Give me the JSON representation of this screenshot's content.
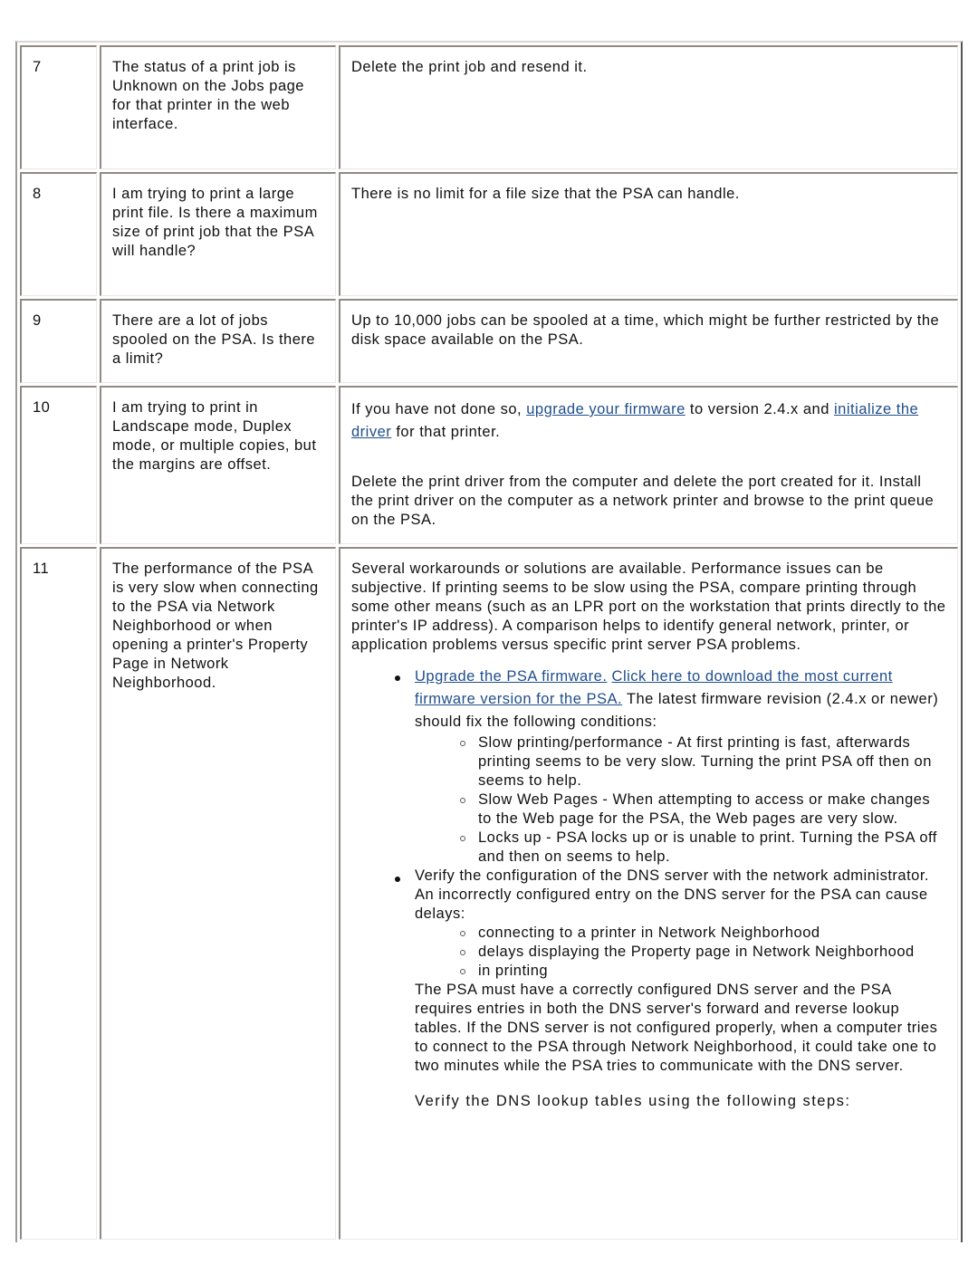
{
  "rows": [
    {
      "number": "7",
      "question": "The status of a print job is Unknown on the Jobs page for that printer in the web interface.",
      "answer": "Delete the print job and resend it."
    },
    {
      "number": "8",
      "question": "I am trying to print a large print file. Is there a maximum size of print job that the PSA will handle?",
      "answer": "There is no limit for a file size that the PSA can handle."
    },
    {
      "number": "9",
      "question": "There are a lot of jobs spooled on the PSA. Is there a limit?",
      "answer": "Up to 10,000 jobs can be spooled at a time, which might be further restricted by the disk space available on the PSA."
    },
    {
      "number": "10",
      "question": "I am trying to print in Landscape mode, Duplex mode, or multiple copies, but the margins are offset.",
      "answer_part1_prefix": "If you have not done so, ",
      "answer_link1": "upgrade your firmware",
      "answer_part1_middle": " to version 2.4.x and ",
      "answer_link2": "initialize the driver",
      "answer_part1_suffix": " for that printer.",
      "answer_part2": "Delete the print driver from the computer and delete the port created for it. Install the print driver on the computer as a network printer and browse to the print queue on the PSA."
    },
    {
      "number": "11",
      "question": "The performance of the PSA is very slow when connecting to the PSA via Network Neighborhood or when opening a printer's Property Page in Network Neighborhood.",
      "answer_intro": "Several workarounds or solutions are available. Performance issues can be subjective. If printing seems to be slow using the PSA, compare printing through some other means (such as an LPR port on the workstation that prints directly to the printer's IP address). A comparison helps to identify general network, printer, or application problems versus specific print server PSA problems.",
      "bullet1": {
        "link1": "Upgrade the PSA firmware.",
        "link2": "Click here to download the most current firmware version for the PSA.",
        "text": " The latest firmware revision (2.4.x or newer) should fix the following conditions:",
        "sub": [
          "Slow printing/performance - At first printing is fast, afterwards printing seems to be very slow. Turning the print PSA off then on seems to help.",
          "Slow Web Pages - When attempting to access or make changes to the Web page for the PSA, the Web pages are very slow.",
          "Locks up - PSA locks up or is unable to print. Turning the PSA off and then on seems to help."
        ]
      },
      "bullet2": {
        "text": "Verify the configuration of the DNS server with the network administrator. An incorrectly configured entry on the DNS server for the PSA can cause delays:",
        "sub": [
          "connecting to a printer in Network Neighborhood",
          "delays displaying the Property page in Network Neighborhood",
          "in printing"
        ]
      },
      "dns_paragraph": "The PSA must have a correctly configured DNS server and the PSA requires entries in both the DNS server's forward and reverse lookup tables. If the DNS server is not configured properly, when a computer tries to connect to the PSA through Network Neighborhood, it could take one to two minutes while the PSA tries to communicate with the DNS server.",
      "steps_intro": "Verify the DNS lookup tables using the following steps:"
    }
  ],
  "colors": {
    "link": "#1f4e8c",
    "text": "#111111",
    "border": "#8f8b82"
  }
}
